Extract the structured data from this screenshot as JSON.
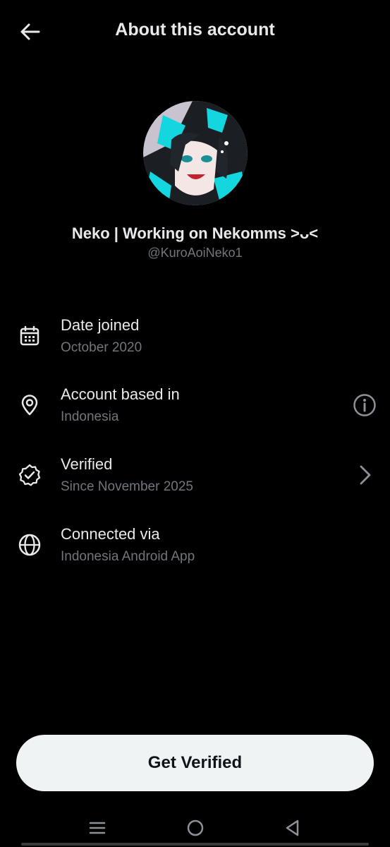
{
  "header": {
    "title": "About this account",
    "back_icon": "arrow-left-icon"
  },
  "profile": {
    "display_name": "Neko | Working on Nekomms ˃ᴗ˂",
    "handle": "@KuroAoiNeko1",
    "avatar_accent": "#13d6de"
  },
  "rows": [
    {
      "icon": "calendar-icon",
      "title": "Date joined",
      "subtitle": "October 2020",
      "action": null
    },
    {
      "icon": "location-pin-icon",
      "title": "Account based in",
      "subtitle": "Indonesia",
      "action": "info-icon"
    },
    {
      "icon": "verified-badge-icon",
      "title": "Verified",
      "subtitle": "Since November 2025",
      "action": "chevron-right-icon"
    },
    {
      "icon": "globe-icon",
      "title": "Connected via",
      "subtitle": "Indonesia Android App",
      "action": null
    }
  ],
  "cta": {
    "label": "Get Verified"
  },
  "system_nav": {
    "items": [
      "menu-icon",
      "home-circle-icon",
      "back-triangle-icon"
    ]
  },
  "colors": {
    "background": "#000000",
    "primary_text": "#e7e9ea",
    "secondary_text": "#71767b",
    "button_bg": "#eff3f4",
    "button_text": "#0f1419"
  }
}
